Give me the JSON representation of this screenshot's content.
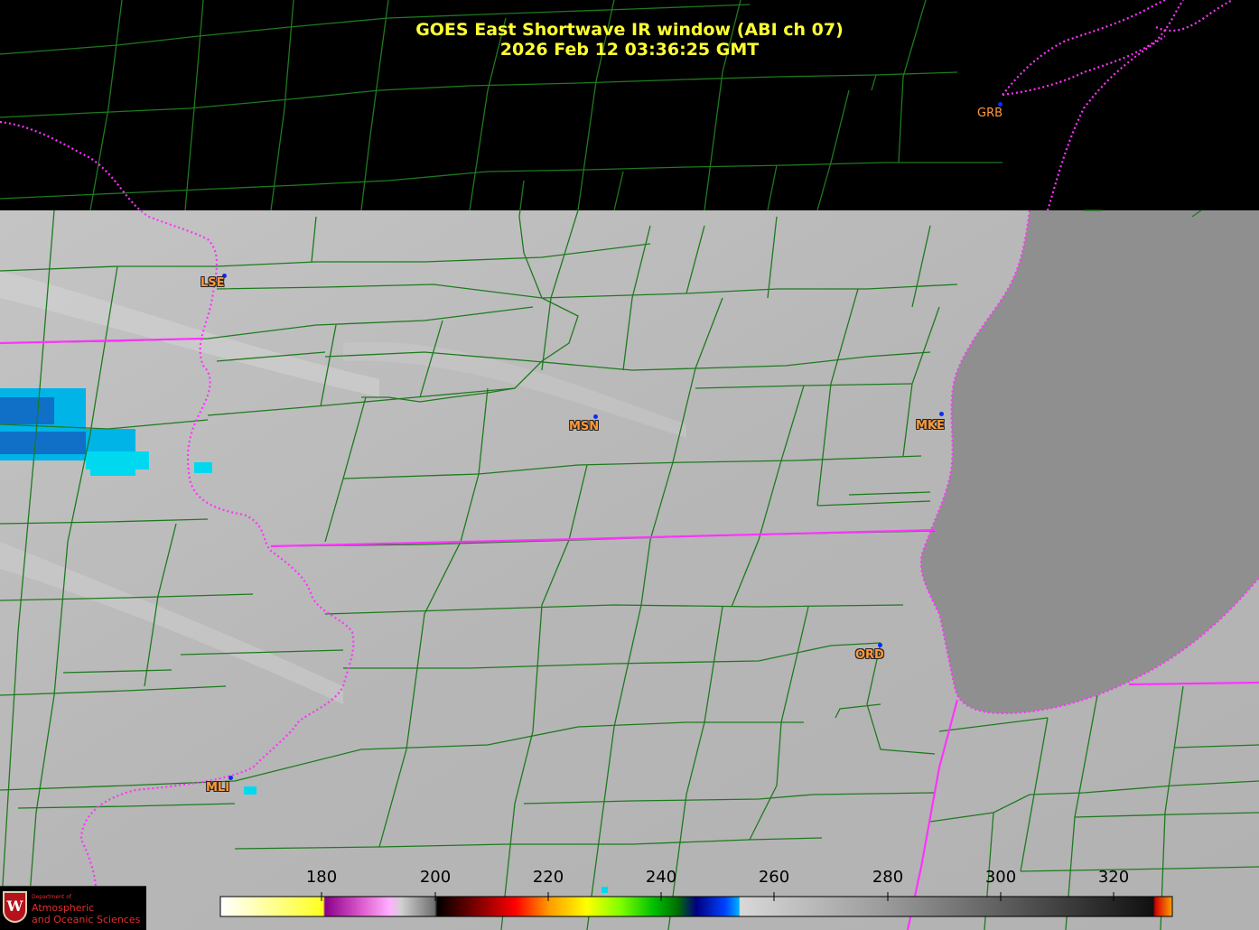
{
  "title": {
    "line1": "GOES East Shortwave IR window (ABI ch 07)",
    "line2": "2026 Feb 12  03:36:25 GMT"
  },
  "cities": [
    {
      "code": "GRB"
    },
    {
      "code": "LSE"
    },
    {
      "code": "MSN"
    },
    {
      "code": "MKE"
    },
    {
      "code": "ORD"
    },
    {
      "code": "MLI"
    }
  ],
  "colorbar": {
    "ticks": [
      "180",
      "200",
      "220",
      "240",
      "260",
      "280",
      "300",
      "320"
    ]
  },
  "logo": {
    "dept": "Department of",
    "line1": "Atmospheric",
    "line2": "and Oceanic Sciences",
    "shield": "W"
  },
  "colors": {
    "background": "#000000",
    "land": "#b8b8b8",
    "lake": "#8f8f8f",
    "county_lines": "#1e7a1e",
    "state_lines": "#ff33ff",
    "title": "#ffff33",
    "city_label": "#ff9a3c",
    "cold_cloud": "#00d8f0"
  }
}
